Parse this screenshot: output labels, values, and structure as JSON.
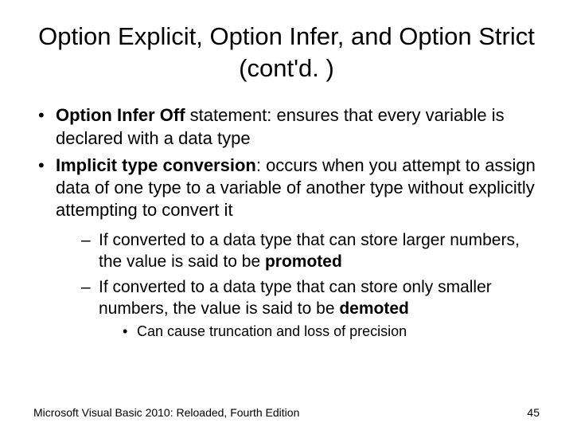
{
  "title": "Option Explicit, Option Infer, and Option Strict (cont'd. )",
  "bullets": [
    {
      "bold": "Option Infer Off",
      "rest": " statement: ensures that every variable is declared with a data type"
    },
    {
      "bold": "Implicit type conversion",
      "rest": ": occurs when you attempt to assign data of one type to a variable of another type without explicitly attempting to convert it"
    }
  ],
  "dashes": [
    {
      "pre": "If converted to a data type that can store larger numbers, the value is said to be ",
      "bold": "promoted"
    },
    {
      "pre": "If converted to a data type that can store only smaller numbers, the value is said to be ",
      "bold": "demoted"
    }
  ],
  "subbullet": "Can cause truncation and loss of precision",
  "footer": {
    "source": "Microsoft Visual Basic 2010: Reloaded, Fourth Edition",
    "page": "45"
  }
}
